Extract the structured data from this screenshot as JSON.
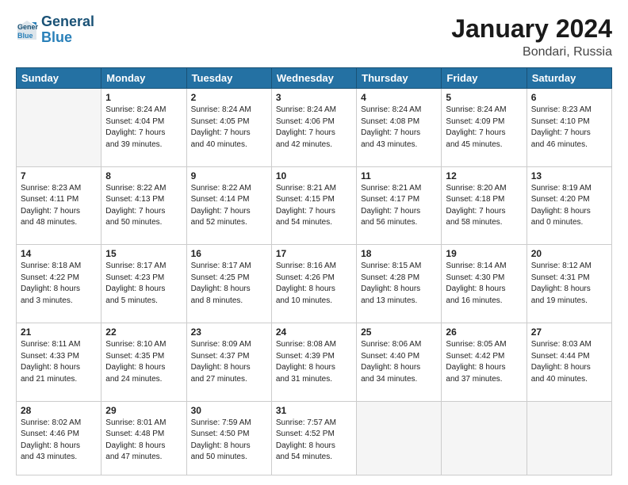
{
  "logo": {
    "line1": "General",
    "line2": "Blue"
  },
  "title": "January 2024",
  "subtitle": "Bondari, Russia",
  "weekdays": [
    "Sunday",
    "Monday",
    "Tuesday",
    "Wednesday",
    "Thursday",
    "Friday",
    "Saturday"
  ],
  "weeks": [
    [
      {
        "day": "",
        "info": ""
      },
      {
        "day": "1",
        "info": "Sunrise: 8:24 AM\nSunset: 4:04 PM\nDaylight: 7 hours\nand 39 minutes."
      },
      {
        "day": "2",
        "info": "Sunrise: 8:24 AM\nSunset: 4:05 PM\nDaylight: 7 hours\nand 40 minutes."
      },
      {
        "day": "3",
        "info": "Sunrise: 8:24 AM\nSunset: 4:06 PM\nDaylight: 7 hours\nand 42 minutes."
      },
      {
        "day": "4",
        "info": "Sunrise: 8:24 AM\nSunset: 4:08 PM\nDaylight: 7 hours\nand 43 minutes."
      },
      {
        "day": "5",
        "info": "Sunrise: 8:24 AM\nSunset: 4:09 PM\nDaylight: 7 hours\nand 45 minutes."
      },
      {
        "day": "6",
        "info": "Sunrise: 8:23 AM\nSunset: 4:10 PM\nDaylight: 7 hours\nand 46 minutes."
      }
    ],
    [
      {
        "day": "7",
        "info": "Sunrise: 8:23 AM\nSunset: 4:11 PM\nDaylight: 7 hours\nand 48 minutes."
      },
      {
        "day": "8",
        "info": "Sunrise: 8:22 AM\nSunset: 4:13 PM\nDaylight: 7 hours\nand 50 minutes."
      },
      {
        "day": "9",
        "info": "Sunrise: 8:22 AM\nSunset: 4:14 PM\nDaylight: 7 hours\nand 52 minutes."
      },
      {
        "day": "10",
        "info": "Sunrise: 8:21 AM\nSunset: 4:15 PM\nDaylight: 7 hours\nand 54 minutes."
      },
      {
        "day": "11",
        "info": "Sunrise: 8:21 AM\nSunset: 4:17 PM\nDaylight: 7 hours\nand 56 minutes."
      },
      {
        "day": "12",
        "info": "Sunrise: 8:20 AM\nSunset: 4:18 PM\nDaylight: 7 hours\nand 58 minutes."
      },
      {
        "day": "13",
        "info": "Sunrise: 8:19 AM\nSunset: 4:20 PM\nDaylight: 8 hours\nand 0 minutes."
      }
    ],
    [
      {
        "day": "14",
        "info": "Sunrise: 8:18 AM\nSunset: 4:22 PM\nDaylight: 8 hours\nand 3 minutes."
      },
      {
        "day": "15",
        "info": "Sunrise: 8:17 AM\nSunset: 4:23 PM\nDaylight: 8 hours\nand 5 minutes."
      },
      {
        "day": "16",
        "info": "Sunrise: 8:17 AM\nSunset: 4:25 PM\nDaylight: 8 hours\nand 8 minutes."
      },
      {
        "day": "17",
        "info": "Sunrise: 8:16 AM\nSunset: 4:26 PM\nDaylight: 8 hours\nand 10 minutes."
      },
      {
        "day": "18",
        "info": "Sunrise: 8:15 AM\nSunset: 4:28 PM\nDaylight: 8 hours\nand 13 minutes."
      },
      {
        "day": "19",
        "info": "Sunrise: 8:14 AM\nSunset: 4:30 PM\nDaylight: 8 hours\nand 16 minutes."
      },
      {
        "day": "20",
        "info": "Sunrise: 8:12 AM\nSunset: 4:31 PM\nDaylight: 8 hours\nand 19 minutes."
      }
    ],
    [
      {
        "day": "21",
        "info": "Sunrise: 8:11 AM\nSunset: 4:33 PM\nDaylight: 8 hours\nand 21 minutes."
      },
      {
        "day": "22",
        "info": "Sunrise: 8:10 AM\nSunset: 4:35 PM\nDaylight: 8 hours\nand 24 minutes."
      },
      {
        "day": "23",
        "info": "Sunrise: 8:09 AM\nSunset: 4:37 PM\nDaylight: 8 hours\nand 27 minutes."
      },
      {
        "day": "24",
        "info": "Sunrise: 8:08 AM\nSunset: 4:39 PM\nDaylight: 8 hours\nand 31 minutes."
      },
      {
        "day": "25",
        "info": "Sunrise: 8:06 AM\nSunset: 4:40 PM\nDaylight: 8 hours\nand 34 minutes."
      },
      {
        "day": "26",
        "info": "Sunrise: 8:05 AM\nSunset: 4:42 PM\nDaylight: 8 hours\nand 37 minutes."
      },
      {
        "day": "27",
        "info": "Sunrise: 8:03 AM\nSunset: 4:44 PM\nDaylight: 8 hours\nand 40 minutes."
      }
    ],
    [
      {
        "day": "28",
        "info": "Sunrise: 8:02 AM\nSunset: 4:46 PM\nDaylight: 8 hours\nand 43 minutes."
      },
      {
        "day": "29",
        "info": "Sunrise: 8:01 AM\nSunset: 4:48 PM\nDaylight: 8 hours\nand 47 minutes."
      },
      {
        "day": "30",
        "info": "Sunrise: 7:59 AM\nSunset: 4:50 PM\nDaylight: 8 hours\nand 50 minutes."
      },
      {
        "day": "31",
        "info": "Sunrise: 7:57 AM\nSunset: 4:52 PM\nDaylight: 8 hours\nand 54 minutes."
      },
      {
        "day": "",
        "info": ""
      },
      {
        "day": "",
        "info": ""
      },
      {
        "day": "",
        "info": ""
      }
    ]
  ]
}
